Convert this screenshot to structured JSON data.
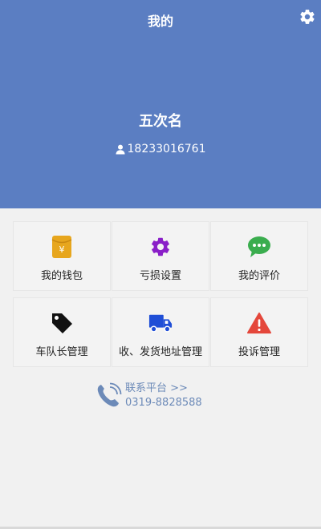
{
  "header": {
    "title": "我的",
    "user_name": "五次名",
    "phone": "18233016761",
    "bg_color": "#5b7ec2"
  },
  "menu": {
    "items": [
      {
        "label": "我的钱包",
        "icon": "wallet-icon",
        "color": "#e7a61d"
      },
      {
        "label": "亏损设置",
        "icon": "gear-icon",
        "color": "#8a1fc8"
      },
      {
        "label": "我的评价",
        "icon": "chat-bubble-icon",
        "color": "#3aad4e"
      },
      {
        "label": "车队长管理",
        "icon": "tag-icon",
        "color": "#111111"
      },
      {
        "label": "收、发货地址管理",
        "icon": "truck-icon",
        "color": "#1f4ed6"
      },
      {
        "label": "投诉管理",
        "icon": "warning-icon",
        "color": "#e4473b"
      }
    ]
  },
  "contact": {
    "label": "联系平台 >>",
    "phone": "0319-8828588"
  }
}
